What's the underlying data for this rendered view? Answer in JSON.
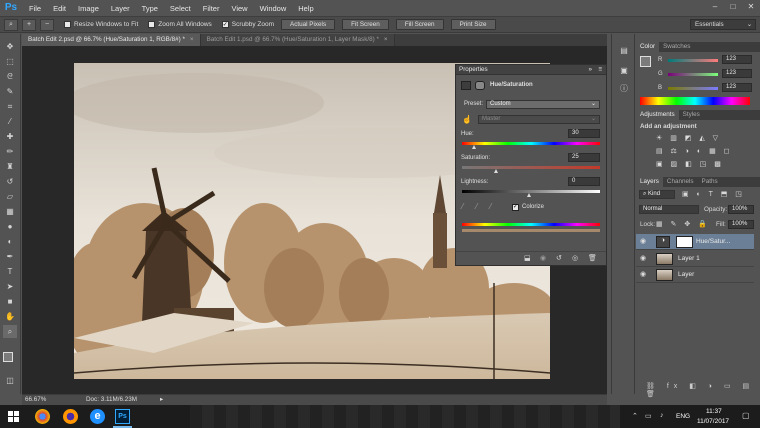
{
  "app": {
    "logo": "Ps"
  },
  "menu": [
    "File",
    "Edit",
    "Image",
    "Layer",
    "Type",
    "Select",
    "Filter",
    "View",
    "Window",
    "Help"
  ],
  "window_controls": {
    "minimize": "–",
    "maximize": "□",
    "close": "✕"
  },
  "options_bar": {
    "resize_windows": "Resize Windows to Fit",
    "zoom_all": "Zoom All Windows",
    "scrubby_zoom": "Scrubby Zoom",
    "scrubby_checked": true,
    "actual_pixels": "Actual Pixels",
    "fit_screen": "Fit Screen",
    "fill_screen": "Fill Screen",
    "print_size": "Print Size",
    "workspace": "Essentials"
  },
  "tabs": [
    {
      "label": "Batch Edit 2.psd @ 66.7% (Hue/Saturation 1, RGB/8#) *",
      "active": true
    },
    {
      "label": "Batch Edit 1.psd @ 66.7% (Hue/Saturation 1, Layer Mask/8) *",
      "active": false
    }
  ],
  "status": {
    "zoom": "66.67%",
    "doc": "Doc: 3.11M/6.23M"
  },
  "properties": {
    "panel_title": "Properties",
    "adjustment_name": "Hue/Saturation",
    "preset_label": "Preset:",
    "preset_value": "Custom",
    "channel_value": "Master",
    "hue_label": "Hue:",
    "hue_value": "30",
    "saturation_label": "Saturation:",
    "saturation_value": "25",
    "lightness_label": "Lightness:",
    "lightness_value": "0",
    "colorize_label": "Colorize",
    "colorize_checked": true
  },
  "color_panel": {
    "tabs": [
      "Color",
      "Swatches"
    ],
    "r": "123",
    "g": "123",
    "b": "123"
  },
  "adjustments_panel": {
    "tabs": [
      "Adjustments",
      "Styles"
    ],
    "add_label": "Add an adjustment"
  },
  "layers_panel": {
    "tabs": [
      "Layers",
      "Channels",
      "Paths"
    ],
    "kind_label": "Kind",
    "blend_mode": "Normal",
    "opacity_label": "Opacity:",
    "opacity_value": "100%",
    "lock_label": "Lock:",
    "fill_label": "Fill:",
    "fill_value": "100%",
    "layers": [
      {
        "name": "Hue/Satur..."
      },
      {
        "name": "Layer 1"
      },
      {
        "name": "Layer"
      }
    ]
  },
  "taskbar": {
    "lang": "ENG",
    "time": "11:37",
    "date": "11/07/2017"
  }
}
